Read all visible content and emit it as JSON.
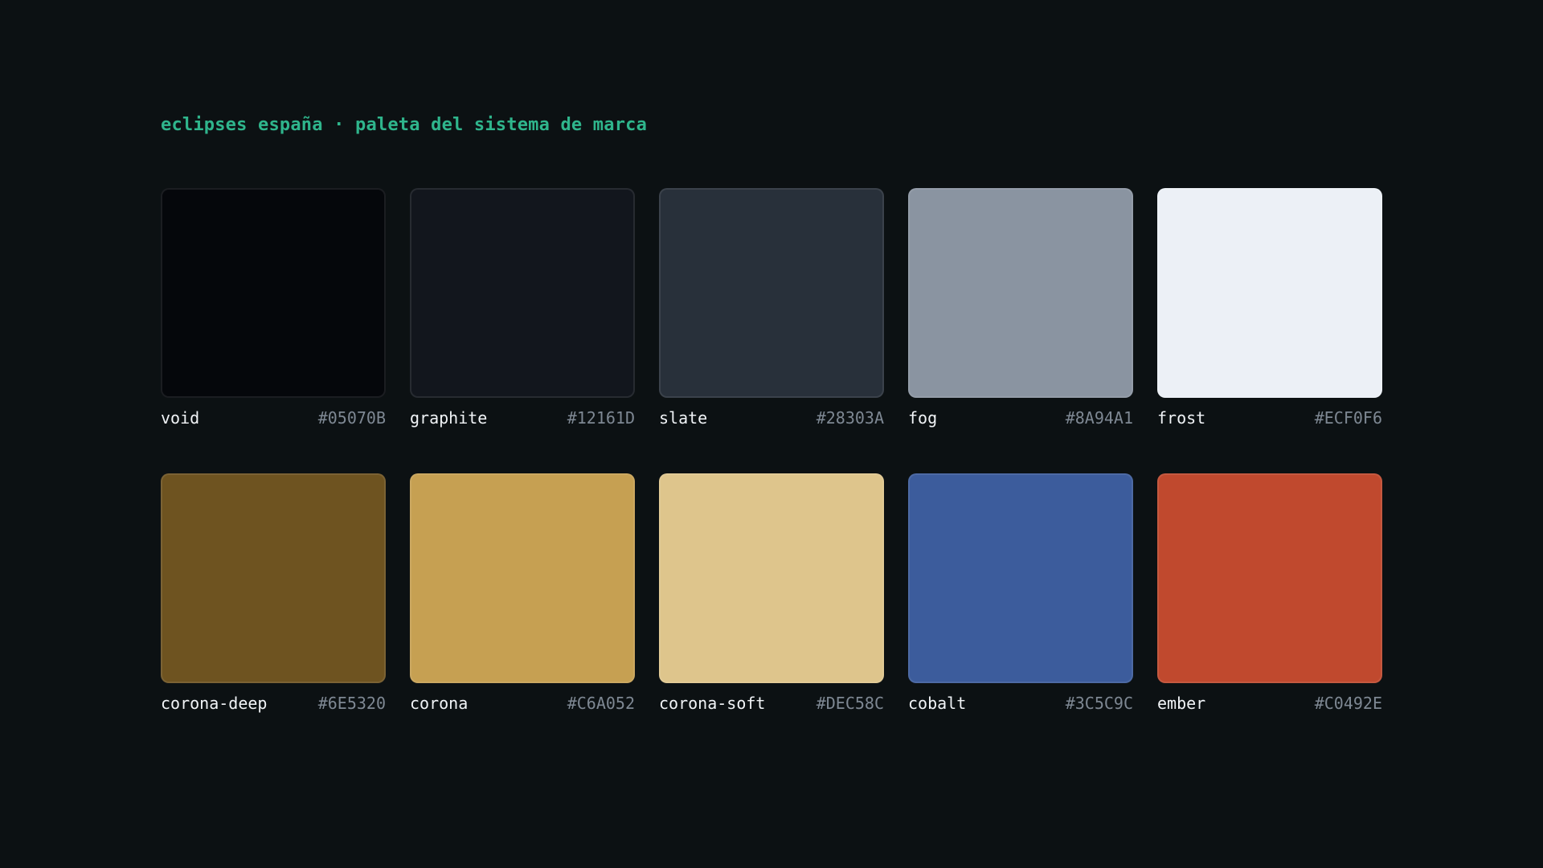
{
  "header": {
    "title": "eclipses españa · paleta del sistema de marca"
  },
  "colors": {
    "title": "#2FB58C",
    "background": "#0C1113"
  },
  "swatches": [
    {
      "name": "void",
      "hex": "#05070B",
      "color": "#05070B"
    },
    {
      "name": "graphite",
      "hex": "#12161D",
      "color": "#12161D"
    },
    {
      "name": "slate",
      "hex": "#28303A",
      "color": "#28303A"
    },
    {
      "name": "fog",
      "hex": "#8A94A1",
      "color": "#8A94A1"
    },
    {
      "name": "frost",
      "hex": "#ECF0F6",
      "color": "#ECF0F6"
    },
    {
      "name": "corona-deep",
      "hex": "#6E5320",
      "color": "#6E5320"
    },
    {
      "name": "corona",
      "hex": "#C6A052",
      "color": "#C6A052"
    },
    {
      "name": "corona-soft",
      "hex": "#DEC58C",
      "color": "#DEC58C"
    },
    {
      "name": "cobalt",
      "hex": "#3C5C9C",
      "color": "#3C5C9C"
    },
    {
      "name": "ember",
      "hex": "#C0492E",
      "color": "#C0492E"
    }
  ]
}
